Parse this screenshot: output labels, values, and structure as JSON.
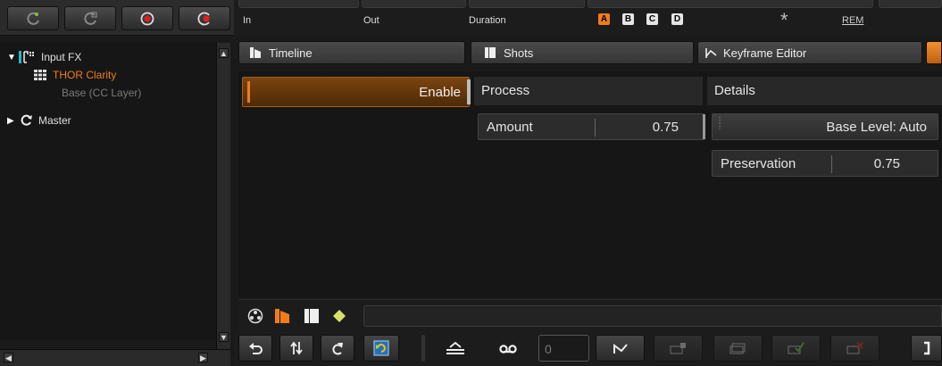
{
  "left_toolbar": {
    "buttons": [
      {
        "icon": "add-grade-icon"
      },
      {
        "icon": "reset-icon"
      },
      {
        "icon": "stop-record-icon"
      },
      {
        "icon": "record-icon"
      }
    ]
  },
  "tree": {
    "root": {
      "label": "Input FX",
      "expanded": true
    },
    "selected": {
      "label": "THOR Clarity"
    },
    "child": {
      "label": "Base (CC Layer)"
    },
    "master": {
      "label": "Master",
      "expanded": false
    }
  },
  "timecode": {
    "in_label": "In",
    "out_label": "Out",
    "duration_label": "Duration",
    "versions": [
      "A",
      "B",
      "C",
      "D"
    ],
    "active_version": "A",
    "rem_label": "REM"
  },
  "tabs": [
    {
      "label": "Timeline",
      "icon": "timeline-icon"
    },
    {
      "label": "Shots",
      "icon": "shots-icon"
    },
    {
      "label": "Keyframe Editor",
      "icon": "keyframe-icon"
    }
  ],
  "effect": {
    "enable_label": "Enable",
    "process": {
      "title": "Process",
      "amount_label": "Amount",
      "amount_value": "0.75"
    },
    "details": {
      "title": "Details",
      "base_level": "Base Level: Auto",
      "preservation_label": "Preservation",
      "preservation_value": "0.75"
    }
  },
  "bottom_toolbar": {
    "frame_value": "0"
  },
  "colors": {
    "accent": "#f07c1a",
    "enable_bg": "#6b3a08",
    "panel": "#232323"
  }
}
